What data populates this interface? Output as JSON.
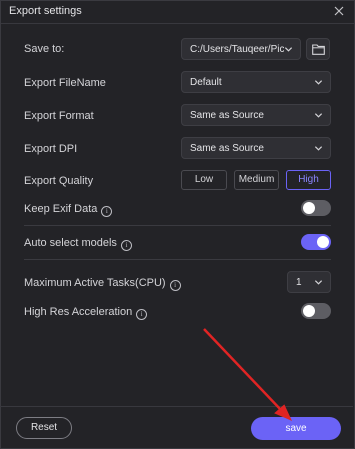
{
  "title": "Export settings",
  "save_to": {
    "label": "Save to:",
    "value": "C:/Users/Tauqeer/Pic..."
  },
  "export_filename": {
    "label": "Export FileName",
    "value": "Default"
  },
  "export_format": {
    "label": "Export Format",
    "value": "Same as Source"
  },
  "export_dpi": {
    "label": "Export DPI",
    "value": "Same as Source"
  },
  "export_quality": {
    "label": "Export Quality",
    "options": [
      "Low",
      "Medium",
      "High"
    ],
    "selected": "High"
  },
  "keep_exif": {
    "label": "Keep Exif Data",
    "enabled": false
  },
  "auto_select": {
    "label": "Auto select models",
    "enabled": true
  },
  "max_tasks": {
    "label": "Maximum Active Tasks(CPU)",
    "value": "1"
  },
  "high_res": {
    "label": "High Res Acceleration",
    "enabled": false
  },
  "footer": {
    "reset_label": "Reset",
    "save_label": "save"
  },
  "info_glyph": "i",
  "colors": {
    "accent": "#6b63f6",
    "annotation_arrow": "#e02424",
    "background": "#232327"
  },
  "icons": [
    "close-icon",
    "folder-icon",
    "chevron-down-icon",
    "info-icon"
  ]
}
